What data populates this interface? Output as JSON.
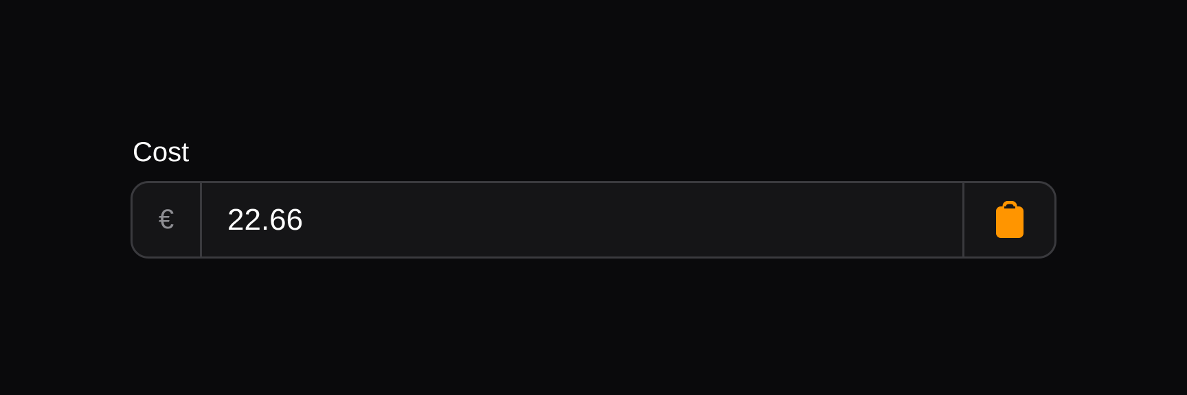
{
  "field": {
    "label": "Cost",
    "currency_symbol": "€",
    "value": "22.66",
    "placeholder": ""
  },
  "icons": {
    "trailing": "clipboard-icon"
  },
  "colors": {
    "background": "#0a0a0c",
    "field_background": "#151517",
    "border": "#3a3a3e",
    "accent": "#ff9500",
    "prefix_text": "#8e8e93"
  }
}
